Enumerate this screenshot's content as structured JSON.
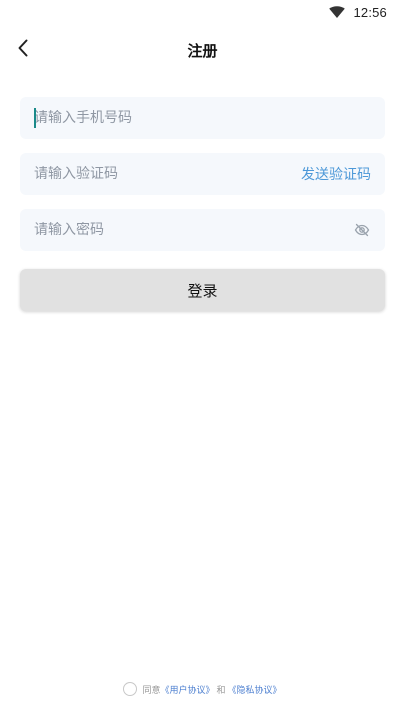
{
  "status_bar": {
    "time": "12:56",
    "wifi_icon": "wifi-icon"
  },
  "nav": {
    "title": "注册",
    "back_icon": "chevron-left-icon"
  },
  "form": {
    "phone_placeholder": "请输入手机号码",
    "code_placeholder": "请输入验证码",
    "send_code_label": "发送验证码",
    "password_placeholder": "请输入密码",
    "password_toggle_icon": "eye-off-icon"
  },
  "submit": {
    "label": "登录"
  },
  "agreement": {
    "prefix": "同意",
    "user_agreement": "《用户协议》",
    "conjunction": "和",
    "privacy_agreement": "《隐私协议》"
  },
  "colors": {
    "accent": "#4c98d8",
    "field_bg": "#f5f8fc",
    "button_bg": "#e1e1e1"
  }
}
